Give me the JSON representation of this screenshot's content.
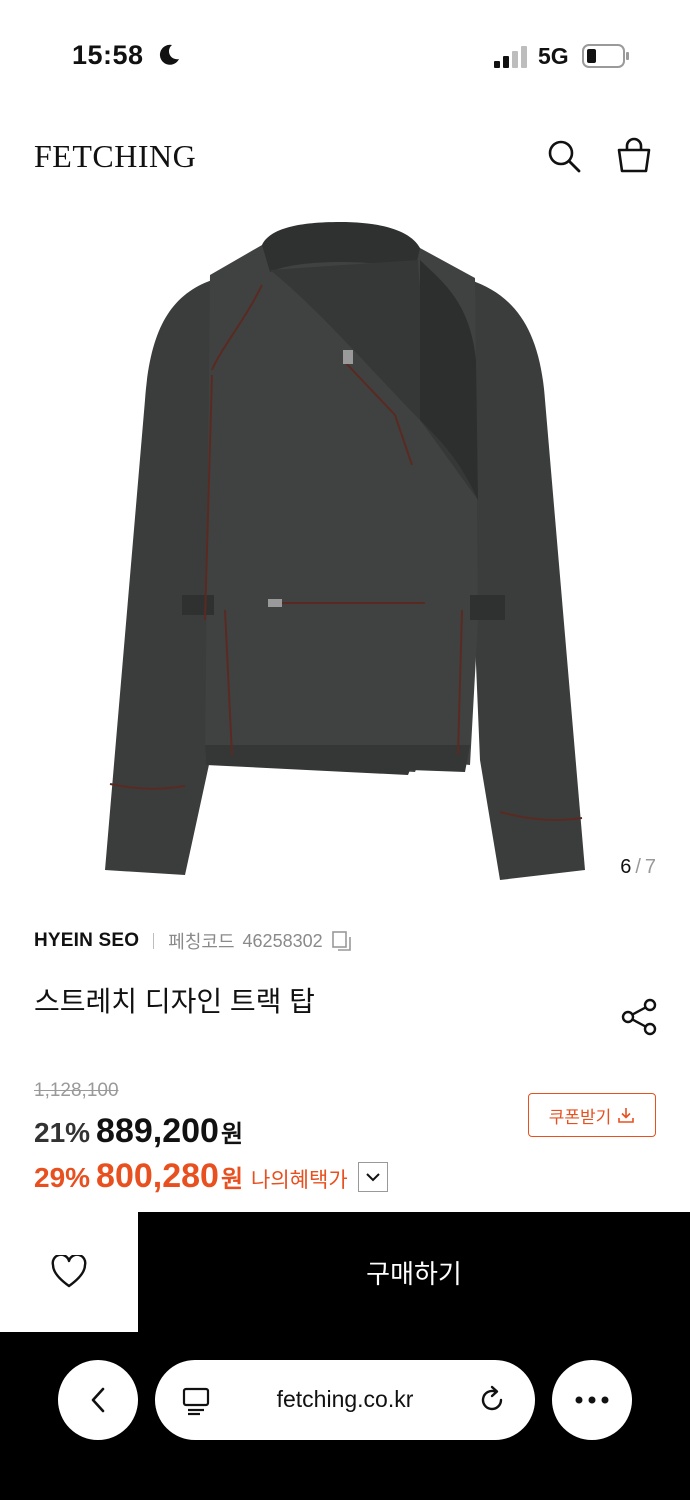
{
  "status": {
    "time": "15:58",
    "network": "5G"
  },
  "header": {
    "logo": "FETCHING"
  },
  "gallery": {
    "current": "6",
    "separator": "/",
    "total": "7"
  },
  "product": {
    "brand": "HYEIN SEO",
    "code_label": "페칭코드",
    "code": "46258302",
    "name": "스트레치 디자인 트랙 탑",
    "original_price": "1,128,100",
    "discount": "21%",
    "price": "889,200",
    "currency": "원",
    "benefit_discount": "29%",
    "benefit_price": "800,280",
    "benefit_currency": "원",
    "benefit_label": "나의혜택가",
    "coupon_label": "쿠폰받기"
  },
  "actions": {
    "buy_label": "구매하기"
  },
  "browser": {
    "url": "fetching.co.kr"
  },
  "colors": {
    "accent": "#e8501f",
    "garment": "#3b3d3c",
    "stitch": "#5a2a22"
  }
}
